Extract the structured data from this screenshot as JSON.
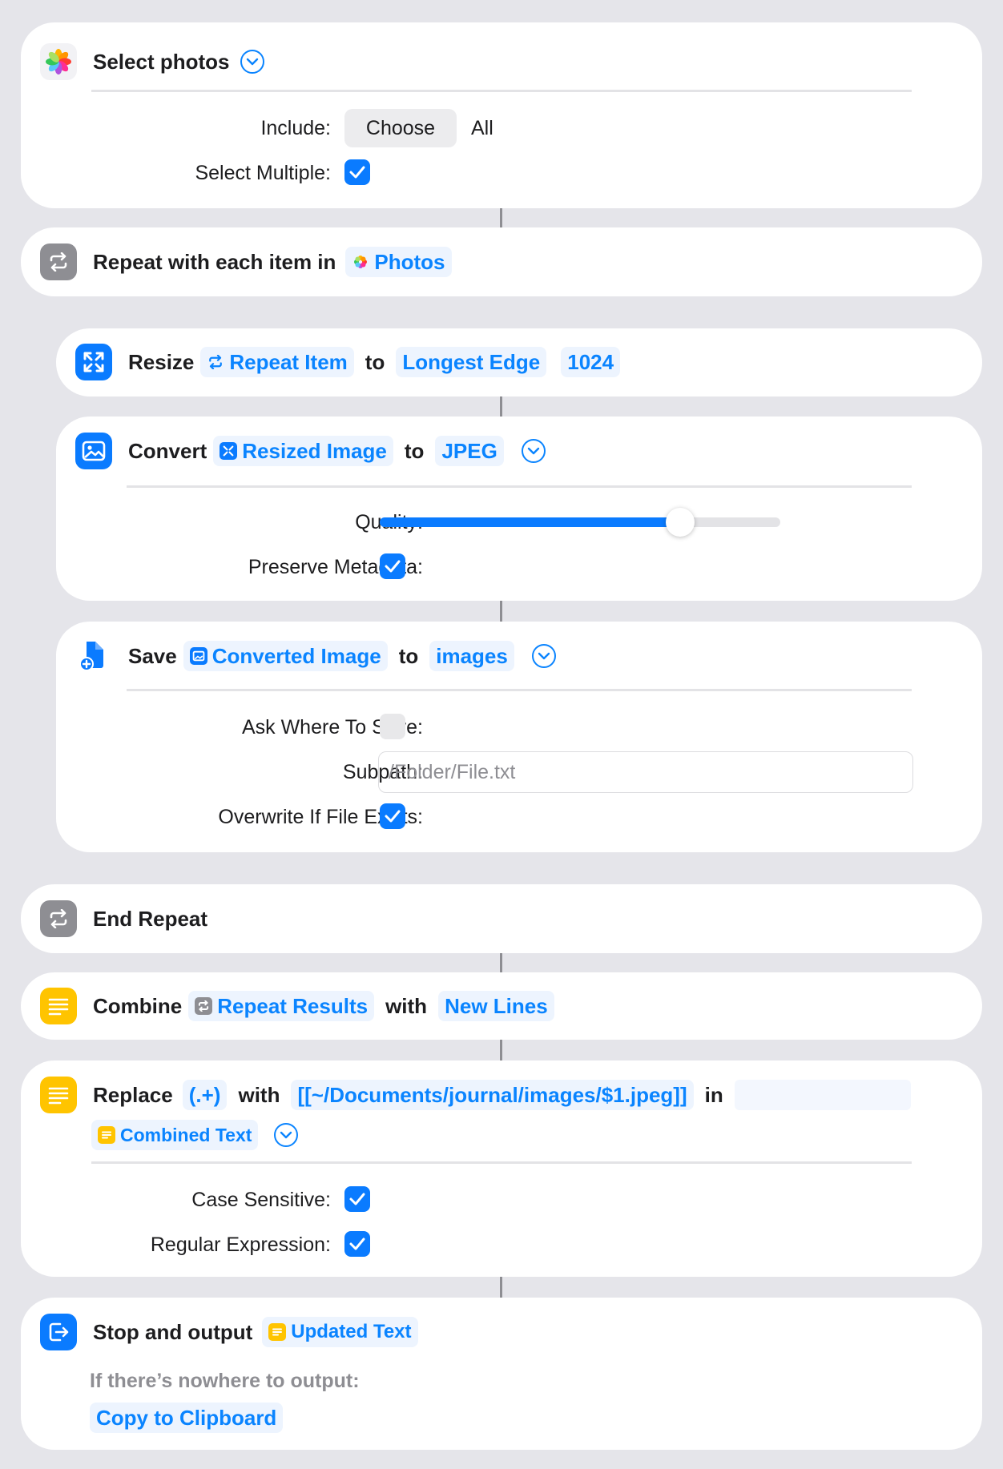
{
  "select_photos": {
    "title": "Select photos",
    "include_label": "Include:",
    "include_choose": "Choose",
    "include_all": "All",
    "select_multiple_label": "Select Multiple:",
    "select_multiple_checked": true
  },
  "repeat": {
    "title": "Repeat with each item in",
    "token": "Photos"
  },
  "resize": {
    "title": "Resize",
    "input_token": "Repeat Item",
    "to": "to",
    "edge_token": "Longest Edge",
    "size_token": "1024"
  },
  "convert": {
    "title": "Convert",
    "input_token": "Resized Image",
    "to": "to",
    "format_token": "JPEG",
    "quality_label": "Quality:",
    "quality_value": 0.75,
    "preserve_label": "Preserve Metadata:",
    "preserve_checked": true
  },
  "save": {
    "title": "Save",
    "input_token": "Converted Image",
    "to": "to",
    "folder_token": "images",
    "ask_label": "Ask Where To Save:",
    "ask_checked": false,
    "subpath_label": "Subpath:",
    "subpath_placeholder": "/Folder/File.txt",
    "overwrite_label": "Overwrite If File Exists:",
    "overwrite_checked": true
  },
  "end_repeat": {
    "title": "End Repeat"
  },
  "combine": {
    "title": "Combine",
    "input_token": "Repeat Results",
    "with": "with",
    "separator_token": "New Lines"
  },
  "replace": {
    "title": "Replace",
    "pattern_token": "(.+)",
    "with": "with",
    "replacement_token": "[[~/Documents/journal/images/$1.jpeg]]",
    "in": "in",
    "target_token": "Combined Text",
    "case_label": "Case Sensitive:",
    "case_checked": true,
    "regex_label": "Regular Expression:",
    "regex_checked": true
  },
  "stop_output": {
    "title": "Stop and output",
    "token": "Updated Text",
    "fallback_label": "If there’s nowhere to output:",
    "fallback_token": "Copy to Clipboard"
  },
  "colors": {
    "accent": "#0a84ff",
    "token_bg": "#edf4fe",
    "gray_icon": "#8e8e93",
    "yellow_icon": "#ffc400"
  }
}
